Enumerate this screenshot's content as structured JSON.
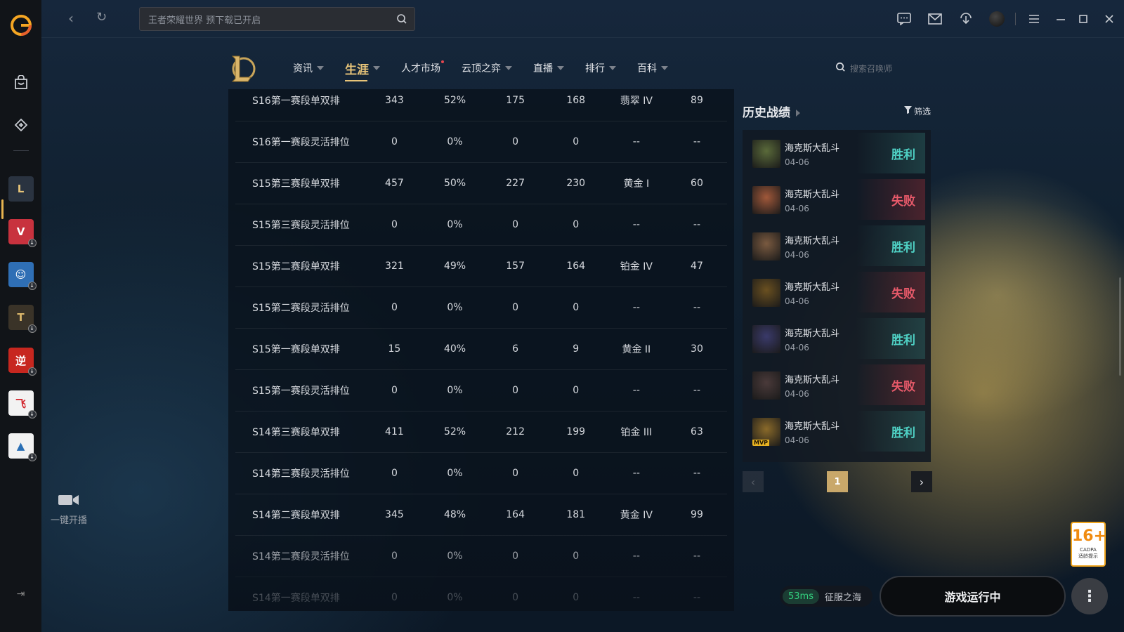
{
  "search": {
    "placeholder": "王者荣耀世界 预下载已开启"
  },
  "nav": {
    "tabs": [
      {
        "label": "资讯",
        "active": false
      },
      {
        "label": "生涯",
        "active": true
      },
      {
        "label": "人才市场",
        "active": false
      },
      {
        "label": "云顶之弈",
        "active": false
      },
      {
        "label": "直播",
        "active": false
      },
      {
        "label": "排行",
        "active": false
      },
      {
        "label": "百科",
        "active": false
      }
    ],
    "search_placeholder": "搜索召唤师"
  },
  "table": {
    "rows": [
      [
        "S16第一赛段单双排",
        "343",
        "52%",
        "175",
        "168",
        "翡翠 IV",
        "89"
      ],
      [
        "S16第一赛段灵活排位",
        "0",
        "0%",
        "0",
        "0",
        "--",
        "--"
      ],
      [
        "S15第三赛段单双排",
        "457",
        "50%",
        "227",
        "230",
        "黄金 I",
        "60"
      ],
      [
        "S15第三赛段灵活排位",
        "0",
        "0%",
        "0",
        "0",
        "--",
        "--"
      ],
      [
        "S15第二赛段单双排",
        "321",
        "49%",
        "157",
        "164",
        "铂金 IV",
        "47"
      ],
      [
        "S15第二赛段灵活排位",
        "0",
        "0%",
        "0",
        "0",
        "--",
        "--"
      ],
      [
        "S15第一赛段单双排",
        "15",
        "40%",
        "6",
        "9",
        "黄金 II",
        "30"
      ],
      [
        "S15第一赛段灵活排位",
        "0",
        "0%",
        "0",
        "0",
        "--",
        "--"
      ],
      [
        "S14第三赛段单双排",
        "411",
        "52%",
        "212",
        "199",
        "铂金 III",
        "63"
      ],
      [
        "S14第三赛段灵活排位",
        "0",
        "0%",
        "0",
        "0",
        "--",
        "--"
      ],
      [
        "S14第二赛段单双排",
        "345",
        "48%",
        "164",
        "181",
        "黄金 IV",
        "99"
      ],
      [
        "S14第二赛段灵活排位",
        "0",
        "0%",
        "0",
        "0",
        "--",
        "--"
      ],
      [
        "S14第一赛段单双排",
        "0",
        "0%",
        "0",
        "0",
        "--",
        "--"
      ]
    ]
  },
  "history": {
    "title": "历史战绩",
    "filter_label": "筛选",
    "matches": [
      {
        "mode": "海克斯大乱斗",
        "date": "04-06",
        "result": "胜利",
        "win": true,
        "avatar_color": "#5a6a3a",
        "mvp": false
      },
      {
        "mode": "海克斯大乱斗",
        "date": "04-06",
        "result": "失败",
        "win": false,
        "avatar_color": "#a0583a",
        "mvp": false
      },
      {
        "mode": "海克斯大乱斗",
        "date": "04-06",
        "result": "胜利",
        "win": true,
        "avatar_color": "#7a5a40",
        "mvp": false
      },
      {
        "mode": "海克斯大乱斗",
        "date": "04-06",
        "result": "失败",
        "win": false,
        "avatar_color": "#6a5020",
        "mvp": false
      },
      {
        "mode": "海克斯大乱斗",
        "date": "04-06",
        "result": "胜利",
        "win": true,
        "avatar_color": "#3a3a6a",
        "mvp": false
      },
      {
        "mode": "海克斯大乱斗",
        "date": "04-06",
        "result": "失败",
        "win": false,
        "avatar_color": "#4a3a3a",
        "mvp": false
      },
      {
        "mode": "海克斯大乱斗",
        "date": "04-06",
        "result": "胜利",
        "win": true,
        "avatar_color": "#8a6a2a",
        "mvp": true,
        "mvp_label": "MVP"
      }
    ],
    "page": "1"
  },
  "stream": {
    "label": "一键开播"
  },
  "status": {
    "ping": "53ms",
    "server": "征服之海"
  },
  "launch_label": "游戏运行中",
  "age_rating": {
    "number": "16+",
    "org": "CADPA",
    "note": "适龄提示"
  },
  "colors": {
    "accent_gold": "#e7c479",
    "win": "#4fd1c5",
    "lose": "#e85a6a"
  }
}
